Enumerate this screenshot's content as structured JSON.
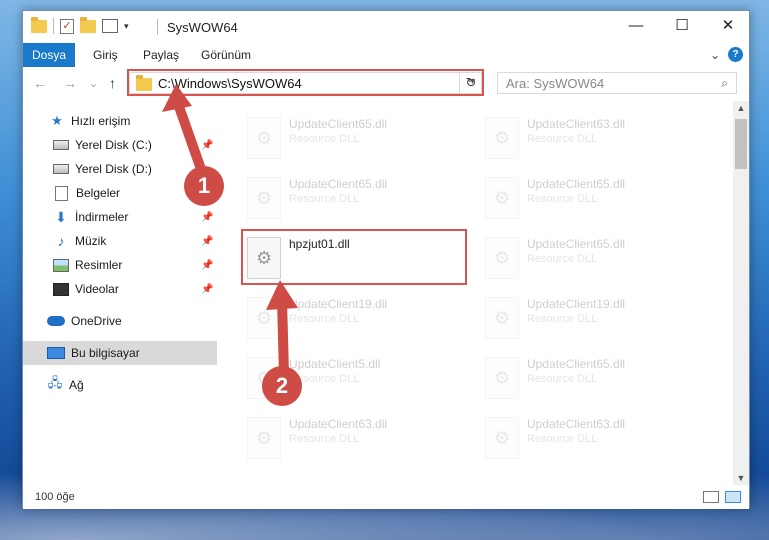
{
  "window": {
    "title": "SysWOW64",
    "minimize_glyph": "—",
    "maximize_glyph": "☐",
    "close_glyph": "✕"
  },
  "ribbon": {
    "tabs": [
      "Dosya",
      "Giriş",
      "Paylaş",
      "Görünüm"
    ],
    "help_icon": "?"
  },
  "address": {
    "path": "C:\\Windows\\SysWOW64",
    "back_glyph": "←",
    "forward_glyph": "→",
    "recent_glyph": "⌄",
    "up_glyph": "↑",
    "refresh_glyph": "↻"
  },
  "search": {
    "placeholder": "Ara: SysWOW64",
    "icon": "search-icon"
  },
  "navpane": {
    "items": [
      {
        "label": "Hızlı erişim",
        "icon": "star-icon",
        "pinned": false
      },
      {
        "label": "Yerel Disk (C:)",
        "icon": "drive-icon",
        "pinned": true
      },
      {
        "label": "Yerel Disk (D:)",
        "icon": "drive-icon",
        "pinned": false
      },
      {
        "label": "Belgeler",
        "icon": "documents-icon",
        "pinned": true
      },
      {
        "label": "İndirmeler",
        "icon": "downloads-icon",
        "pinned": true
      },
      {
        "label": "Müzik",
        "icon": "music-icon",
        "pinned": true
      },
      {
        "label": "Resimler",
        "icon": "pictures-icon",
        "pinned": true
      },
      {
        "label": "Videolar",
        "icon": "videos-icon",
        "pinned": true
      },
      {
        "label": "OneDrive",
        "icon": "onedrive-icon",
        "pinned": false
      },
      {
        "label": "Bu bilgisayar",
        "icon": "computer-icon",
        "pinned": false,
        "selected": true
      },
      {
        "label": "Ağ",
        "icon": "network-icon",
        "pinned": false
      }
    ]
  },
  "files": {
    "left": [
      {
        "name": "UpdateClient65.dll",
        "type": "Resource DLL"
      },
      {
        "name": "UpdateClient65.dll",
        "type": "Resource DLL"
      },
      {
        "name": "hpzjut01.dll",
        "type": ""
      },
      {
        "name": "UpdateClient19.dll",
        "type": "Resource DLL"
      },
      {
        "name": "UpdateClient5.dll",
        "type": "Resource DLL"
      },
      {
        "name": "UpdateClient63.dll",
        "type": "Resource DLL"
      }
    ],
    "right": [
      {
        "name": "UpdateClient63.dll",
        "type": "Resource DLL"
      },
      {
        "name": "UpdateClient65.dll",
        "type": "Resource DLL"
      },
      {
        "name": "UpdateClient65.dll",
        "type": "Resource DLL"
      },
      {
        "name": "UpdateClient19.dll",
        "type": "Resource DLL"
      },
      {
        "name": "UpdateClient65.dll",
        "type": "Resource DLL"
      },
      {
        "name": "UpdateClient63.dll",
        "type": "Resource DLL"
      }
    ]
  },
  "status": {
    "count": "100 öğe"
  },
  "annotations": {
    "step1": "1",
    "step2": "2",
    "color": "#cf4b45"
  }
}
